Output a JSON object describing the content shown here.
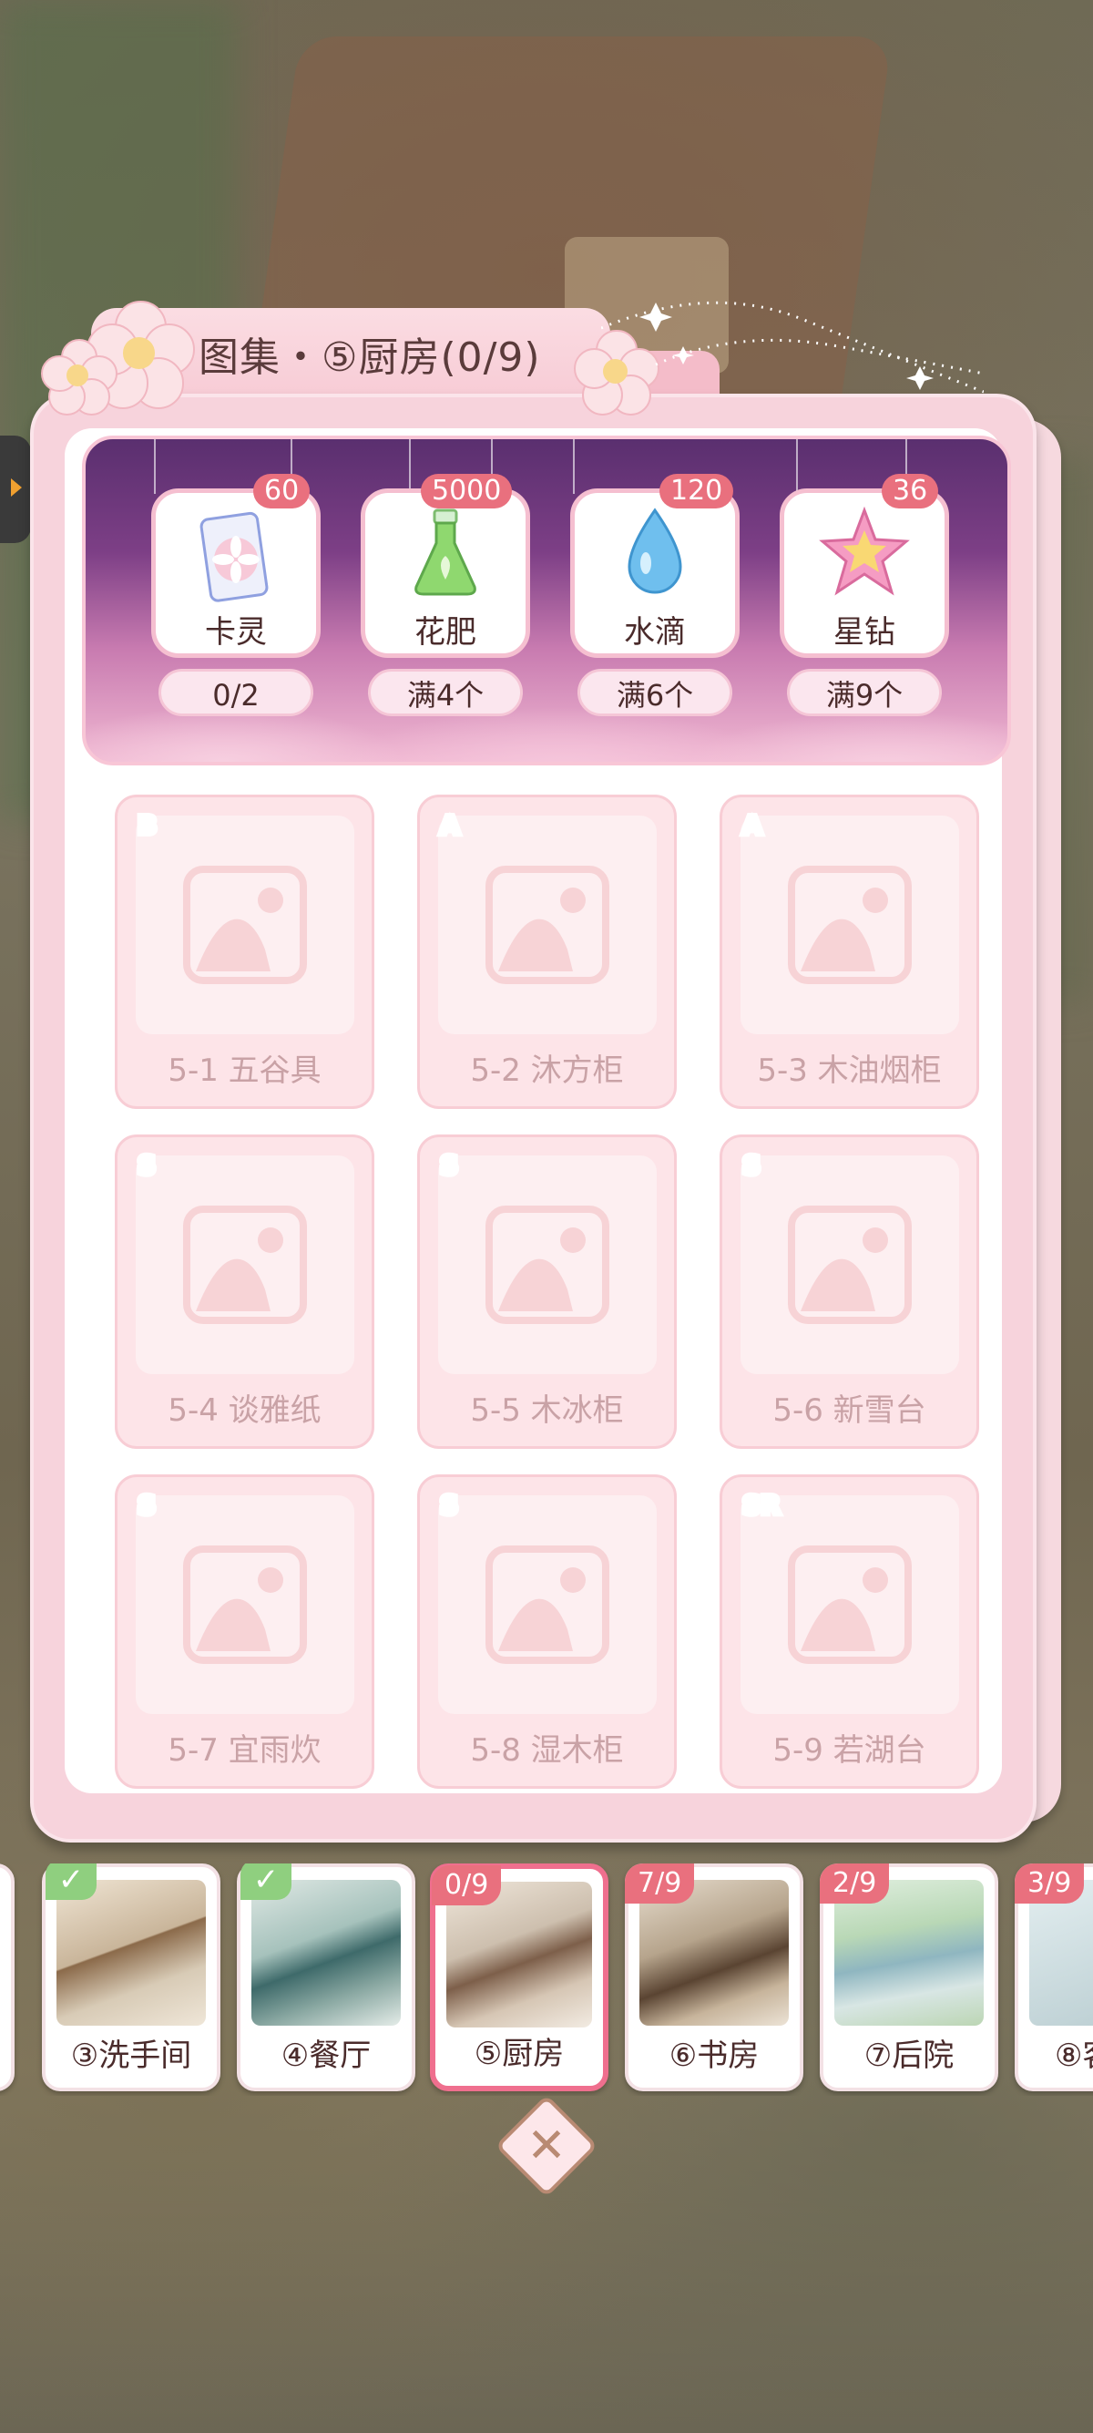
{
  "title": "图集・⑤厨房(0/9)",
  "rewards": [
    {
      "name": "卡灵",
      "count": "60",
      "condition": "0/2",
      "icon": "card-icon"
    },
    {
      "name": "花肥",
      "count": "5000",
      "condition": "满4个",
      "icon": "fertilizer-flask-icon"
    },
    {
      "name": "水滴",
      "count": "120",
      "condition": "满6个",
      "icon": "water-drop-icon"
    },
    {
      "name": "星钻",
      "count": "36",
      "condition": "满9个",
      "icon": "star-diamond-icon"
    }
  ],
  "items": [
    {
      "rarity": "B",
      "label": "5-1 五谷具"
    },
    {
      "rarity": "A",
      "label": "5-2 沐方柜"
    },
    {
      "rarity": "A",
      "label": "5-3 木油烟柜"
    },
    {
      "rarity": "S",
      "label": "5-4 谈雅纸"
    },
    {
      "rarity": "S",
      "label": "5-5 木冰柜"
    },
    {
      "rarity": "S",
      "label": "5-6 新雪台"
    },
    {
      "rarity": "S",
      "label": "5-7 宜雨炊"
    },
    {
      "rarity": "S",
      "label": "5-8 湿木柜"
    },
    {
      "rarity": "SR",
      "label": "5-9 若湖台"
    }
  ],
  "rooms": [
    {
      "label": "③洗手间",
      "status": "check"
    },
    {
      "label": "④餐厅",
      "status": "check"
    },
    {
      "label": "⑤厨房",
      "badge": "0/9",
      "active": true
    },
    {
      "label": "⑥书房",
      "badge": "7/9"
    },
    {
      "label": "⑦后院",
      "badge": "2/9"
    },
    {
      "label": "⑧客",
      "badge": "3/9"
    }
  ],
  "colors": {
    "accent": "#e9707e",
    "panel": "#f7d3dc",
    "banner": "#7d3f86"
  }
}
